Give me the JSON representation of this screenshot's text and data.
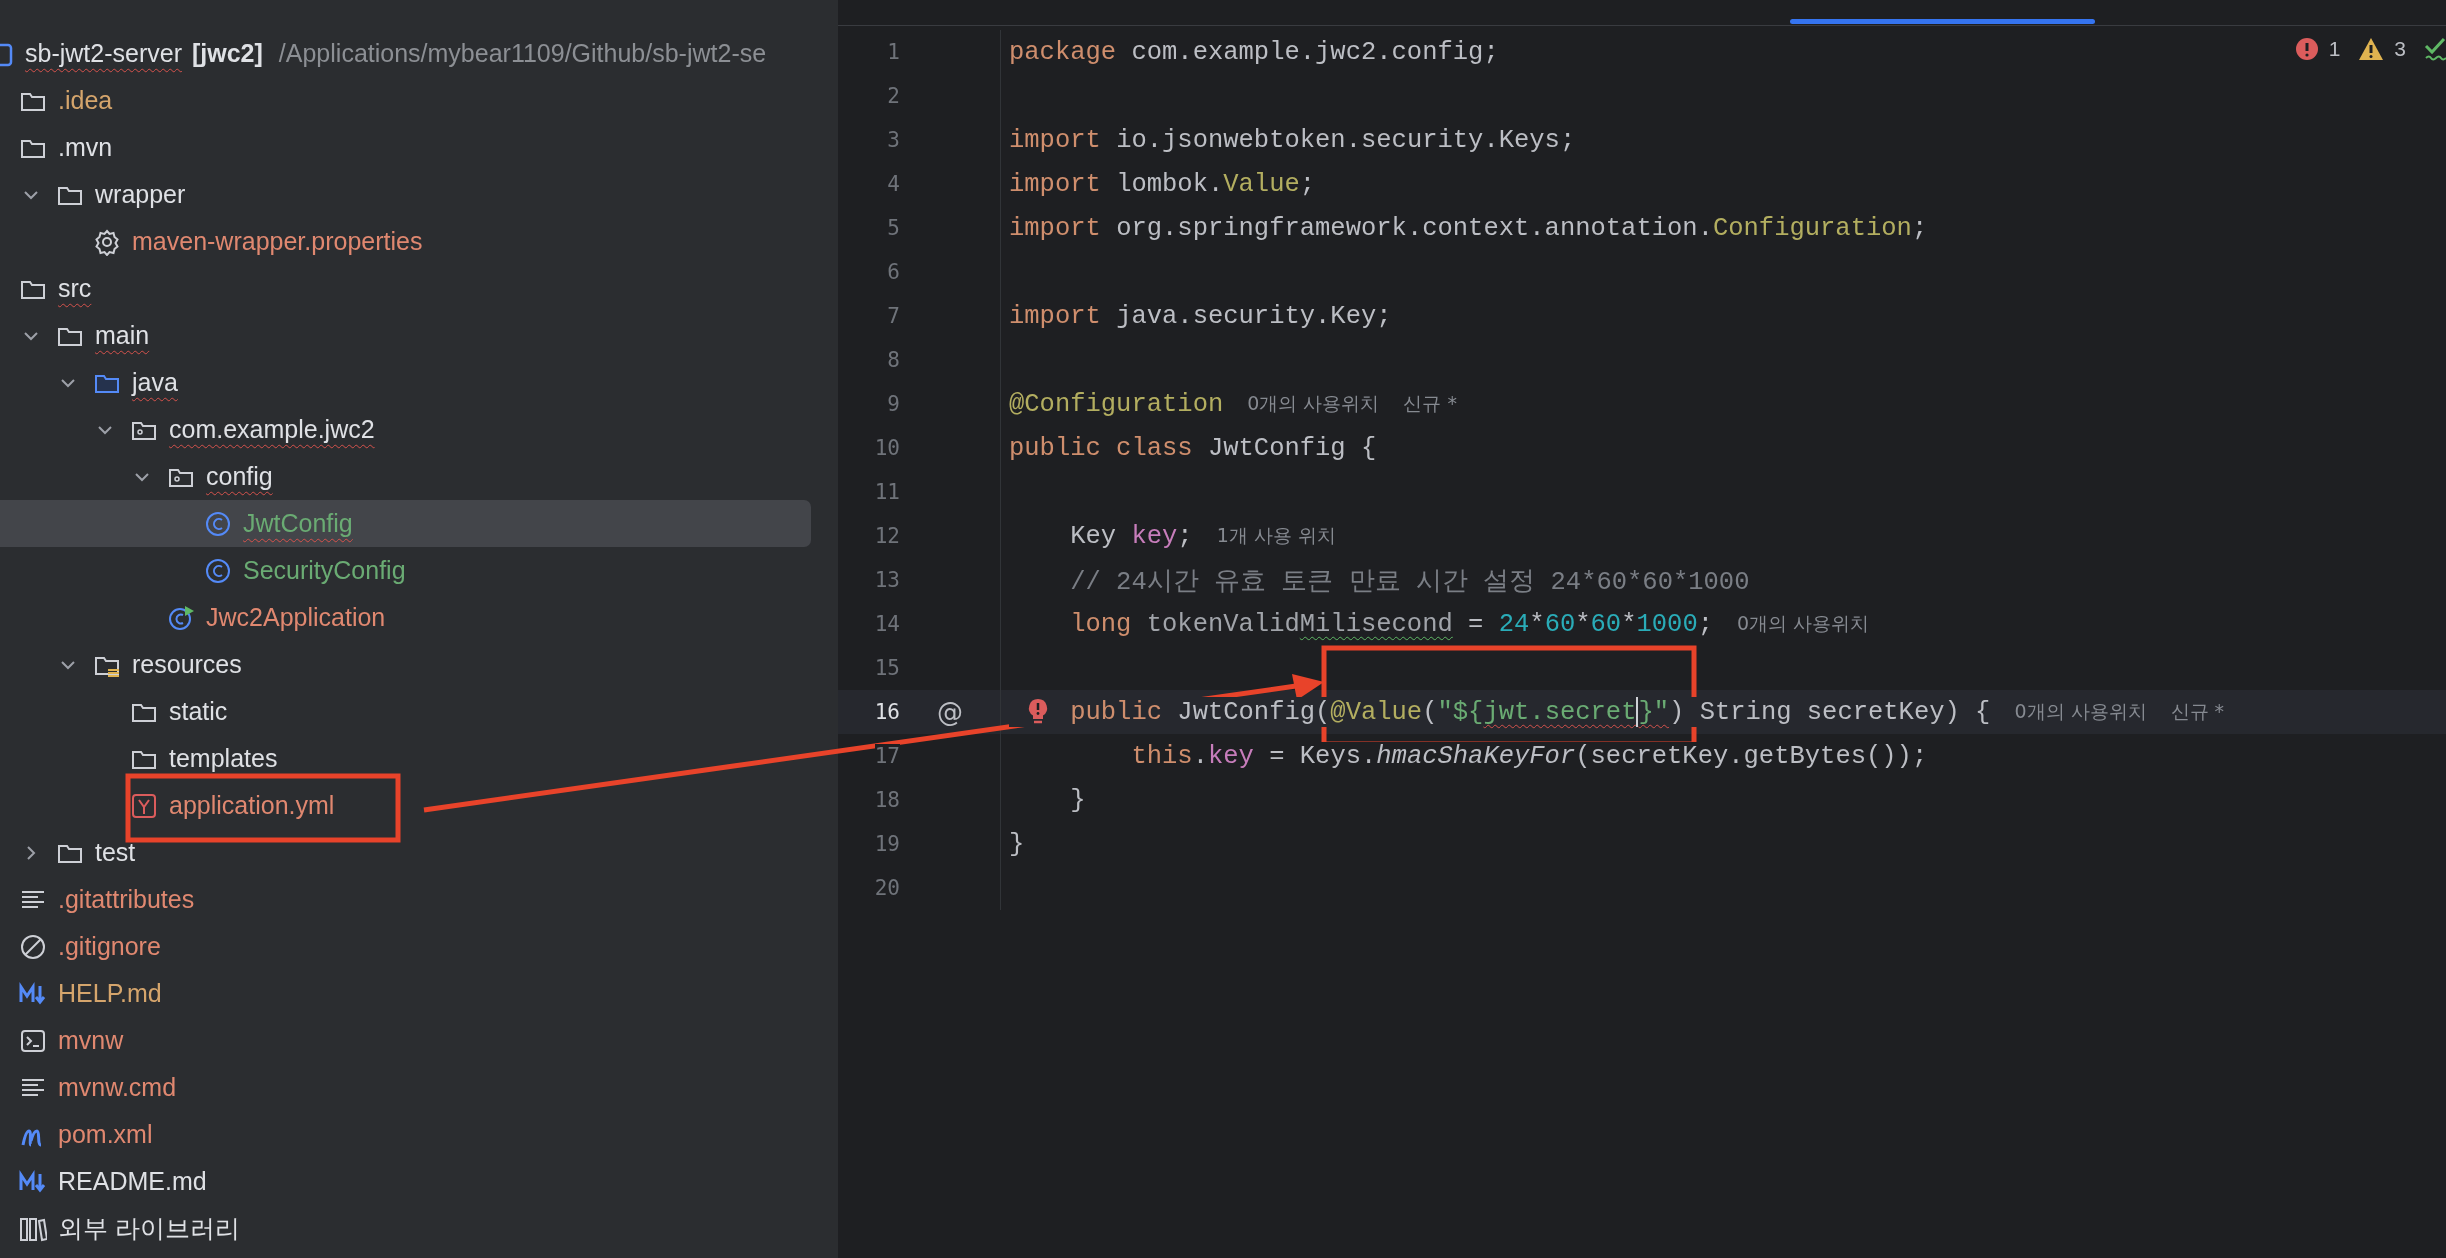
{
  "project_tree": {
    "root": {
      "name": "sb-jwt2-server",
      "module": "[jwc2]",
      "path": "/Applications/mybear1109/Github/sb-jwt2-se",
      "has_errors": true
    },
    "items": [
      {
        "kind": "folder",
        "name": ".idea",
        "color": "#d5a56c",
        "has_errors": false,
        "selected": false
      },
      {
        "kind": "folder",
        "name": ".mvn",
        "color": "#dfe1e5",
        "has_errors": false,
        "selected": false,
        "children": [
          {
            "kind": "folder",
            "name": "wrapper",
            "color": "#dfe1e5",
            "has_errors": false,
            "selected": false,
            "expanded": true,
            "children": [
              {
                "kind": "settings",
                "name": "maven-wrapper.properties",
                "color": "#e08870",
                "has_errors": false,
                "selected": false
              }
            ]
          }
        ]
      },
      {
        "kind": "folder",
        "name": "src",
        "color": "#dfe1e5",
        "has_errors": true,
        "selected": false,
        "children": [
          {
            "kind": "folder",
            "name": "main",
            "color": "#dfe1e5",
            "has_errors": true,
            "selected": false,
            "expanded": true,
            "children": [
              {
                "kind": "source_folder",
                "name": "java",
                "color": "#dfe1e5",
                "has_errors": true,
                "selected": false,
                "expanded": true,
                "children": [
                  {
                    "kind": "package",
                    "name": "com.example.jwc2",
                    "color": "#dfe1e5",
                    "has_errors": true,
                    "selected": false,
                    "expanded": true,
                    "children": [
                      {
                        "kind": "package",
                        "name": "config",
                        "color": "#dfe1e5",
                        "has_errors": true,
                        "selected": false,
                        "expanded": true,
                        "children": [
                          {
                            "kind": "class",
                            "name": "JwtConfig",
                            "color": "#6aab73",
                            "has_errors": true,
                            "selected": true
                          },
                          {
                            "kind": "class",
                            "name": "SecurityConfig",
                            "color": "#6aab73",
                            "has_errors": false,
                            "selected": false
                          }
                        ]
                      },
                      {
                        "kind": "app_class",
                        "name": "Jwc2Application",
                        "color": "#e08870",
                        "has_errors": false,
                        "selected": false
                      }
                    ]
                  }
                ]
              },
              {
                "kind": "resource_folder",
                "name": "resources",
                "color": "#dfe1e5",
                "has_errors": false,
                "selected": false,
                "expanded": true,
                "children": [
                  {
                    "kind": "folder",
                    "name": "static",
                    "color": "#dfe1e5",
                    "has_errors": false,
                    "selected": false
                  },
                  {
                    "kind": "folder",
                    "name": "templates",
                    "color": "#dfe1e5",
                    "has_errors": false,
                    "selected": false
                  },
                  {
                    "kind": "yaml",
                    "name": "application.yml",
                    "color": "#e08870",
                    "has_errors": false,
                    "selected": false
                  }
                ]
              }
            ]
          },
          {
            "kind": "folder",
            "name": "test",
            "color": "#dfe1e5",
            "has_errors": false,
            "selected": false,
            "expanded": false
          }
        ]
      },
      {
        "kind": "text",
        "name": ".gitattributes",
        "color": "#e08870",
        "has_errors": false,
        "selected": false
      },
      {
        "kind": "ignore",
        "name": ".gitignore",
        "color": "#e08870",
        "has_errors": false,
        "selected": false
      },
      {
        "kind": "markdown",
        "name": "HELP.md",
        "color": "#d5a56c",
        "has_errors": false,
        "selected": false
      },
      {
        "kind": "terminal",
        "name": "mvnw",
        "color": "#e08870",
        "has_errors": false,
        "selected": false
      },
      {
        "kind": "text",
        "name": "mvnw.cmd",
        "color": "#e08870",
        "has_errors": false,
        "selected": false
      },
      {
        "kind": "maven",
        "name": "pom.xml",
        "color": "#e08870",
        "has_errors": false,
        "selected": false
      },
      {
        "kind": "markdown",
        "name": "README.md",
        "color": "#dfe1e5",
        "has_errors": false,
        "selected": false
      },
      {
        "kind": "libraries",
        "name": "외부 라이브러리",
        "color": "#dfe1e5",
        "has_errors": false,
        "selected": false
      }
    ]
  },
  "editor": {
    "inspections": {
      "errors": "1",
      "warnings": "3"
    },
    "lines": [
      {
        "number": "1",
        "tokens": [
          {
            "kind": "keyword",
            "text": "package"
          },
          {
            "kind": "plain",
            "text": " com.example.jwc2.config;"
          }
        ]
      },
      {
        "number": "2"
      },
      {
        "number": "3",
        "tokens": [
          {
            "kind": "keyword",
            "text": "import"
          },
          {
            "kind": "plain",
            "text": " io.jsonwebtoken.security.Keys;"
          }
        ]
      },
      {
        "number": "4",
        "tokens": [
          {
            "kind": "keyword",
            "text": "import"
          },
          {
            "kind": "plain",
            "text": " lombok."
          },
          {
            "kind": "type",
            "text": "Value"
          },
          {
            "kind": "plain",
            "text": ";"
          }
        ]
      },
      {
        "number": "5",
        "tokens": [
          {
            "kind": "keyword",
            "text": "import"
          },
          {
            "kind": "plain",
            "text": " org.springframework.context.annotation."
          },
          {
            "kind": "type",
            "text": "Configuration"
          },
          {
            "kind": "plain",
            "text": ";"
          }
        ]
      },
      {
        "number": "6"
      },
      {
        "number": "7",
        "tokens": [
          {
            "kind": "keyword",
            "text": "import"
          },
          {
            "kind": "plain",
            "text": " java.security.Key;"
          }
        ]
      },
      {
        "number": "8"
      },
      {
        "number": "9",
        "tokens": [
          {
            "kind": "annotation",
            "text": "@Configuration"
          }
        ],
        "hints": [
          "0개의 사용위치",
          "신규 *"
        ]
      },
      {
        "number": "10",
        "tokens": [
          {
            "kind": "keyword",
            "text": "public class"
          },
          {
            "kind": "plain",
            "text": " JwtConfig {"
          }
        ]
      },
      {
        "number": "11"
      },
      {
        "number": "12",
        "tokens": [
          {
            "kind": "plain",
            "text": "    Key "
          },
          {
            "kind": "field",
            "text": "key"
          },
          {
            "kind": "plain",
            "text": ";"
          }
        ],
        "hints": [
          "1개 사용 위치"
        ]
      },
      {
        "number": "13",
        "tokens": [
          {
            "kind": "comment",
            "text": "    // 24시간 유효 토큰 만료 시간 설정 24*60*60*1000"
          }
        ]
      },
      {
        "number": "14",
        "tokens": [
          {
            "kind": "keyword",
            "text": "    long"
          },
          {
            "kind": "unused",
            "text": " tokenValid"
          },
          {
            "kind": "unused",
            "text": "Milisecond",
            "typo_underline": true
          },
          {
            "kind": "plain",
            "text": " = "
          },
          {
            "kind": "number",
            "text": "24"
          },
          {
            "kind": "plain",
            "text": "*"
          },
          {
            "kind": "number",
            "text": "60"
          },
          {
            "kind": "plain",
            "text": "*"
          },
          {
            "kind": "number",
            "text": "60"
          },
          {
            "kind": "plain",
            "text": "*"
          },
          {
            "kind": "number",
            "text": "1000"
          },
          {
            "kind": "plain",
            "text": ";"
          }
        ],
        "hints": [
          "0개의 사용위치"
        ]
      },
      {
        "number": "15"
      },
      {
        "number": "16",
        "current": true,
        "gutter_mark": "@",
        "error_bulb": true,
        "tokens": [
          {
            "kind": "keyword",
            "text": "    public"
          },
          {
            "kind": "plain",
            "text": " JwtConfig("
          },
          {
            "kind": "annotation",
            "text": "@Value"
          },
          {
            "kind": "plain",
            "text": "("
          },
          {
            "kind": "string",
            "text": "\"${"
          },
          {
            "kind": "string",
            "text": "jwt.secret",
            "error_underline": true,
            "caret": true
          },
          {
            "kind": "string",
            "text": "}\"",
            "error_underline": true
          },
          {
            "kind": "plain",
            "text": ") String secretKey) {"
          }
        ],
        "hints": [
          "0개의 사용위치",
          "신규 *"
        ]
      },
      {
        "number": "17",
        "tokens": [
          {
            "kind": "keyword",
            "text": "        this"
          },
          {
            "kind": "plain",
            "text": "."
          },
          {
            "kind": "field",
            "text": "key"
          },
          {
            "kind": "plain",
            "text": " = Keys."
          },
          {
            "kind": "method",
            "text": "hmacShaKeyFor"
          },
          {
            "kind": "plain",
            "text": "(secretKey.getBytes());"
          }
        ]
      },
      {
        "number": "18",
        "tokens": [
          {
            "kind": "plain",
            "text": "    }"
          }
        ]
      },
      {
        "number": "19",
        "tokens": [
          {
            "kind": "plain",
            "text": "}"
          }
        ]
      },
      {
        "number": "20"
      }
    ]
  }
}
